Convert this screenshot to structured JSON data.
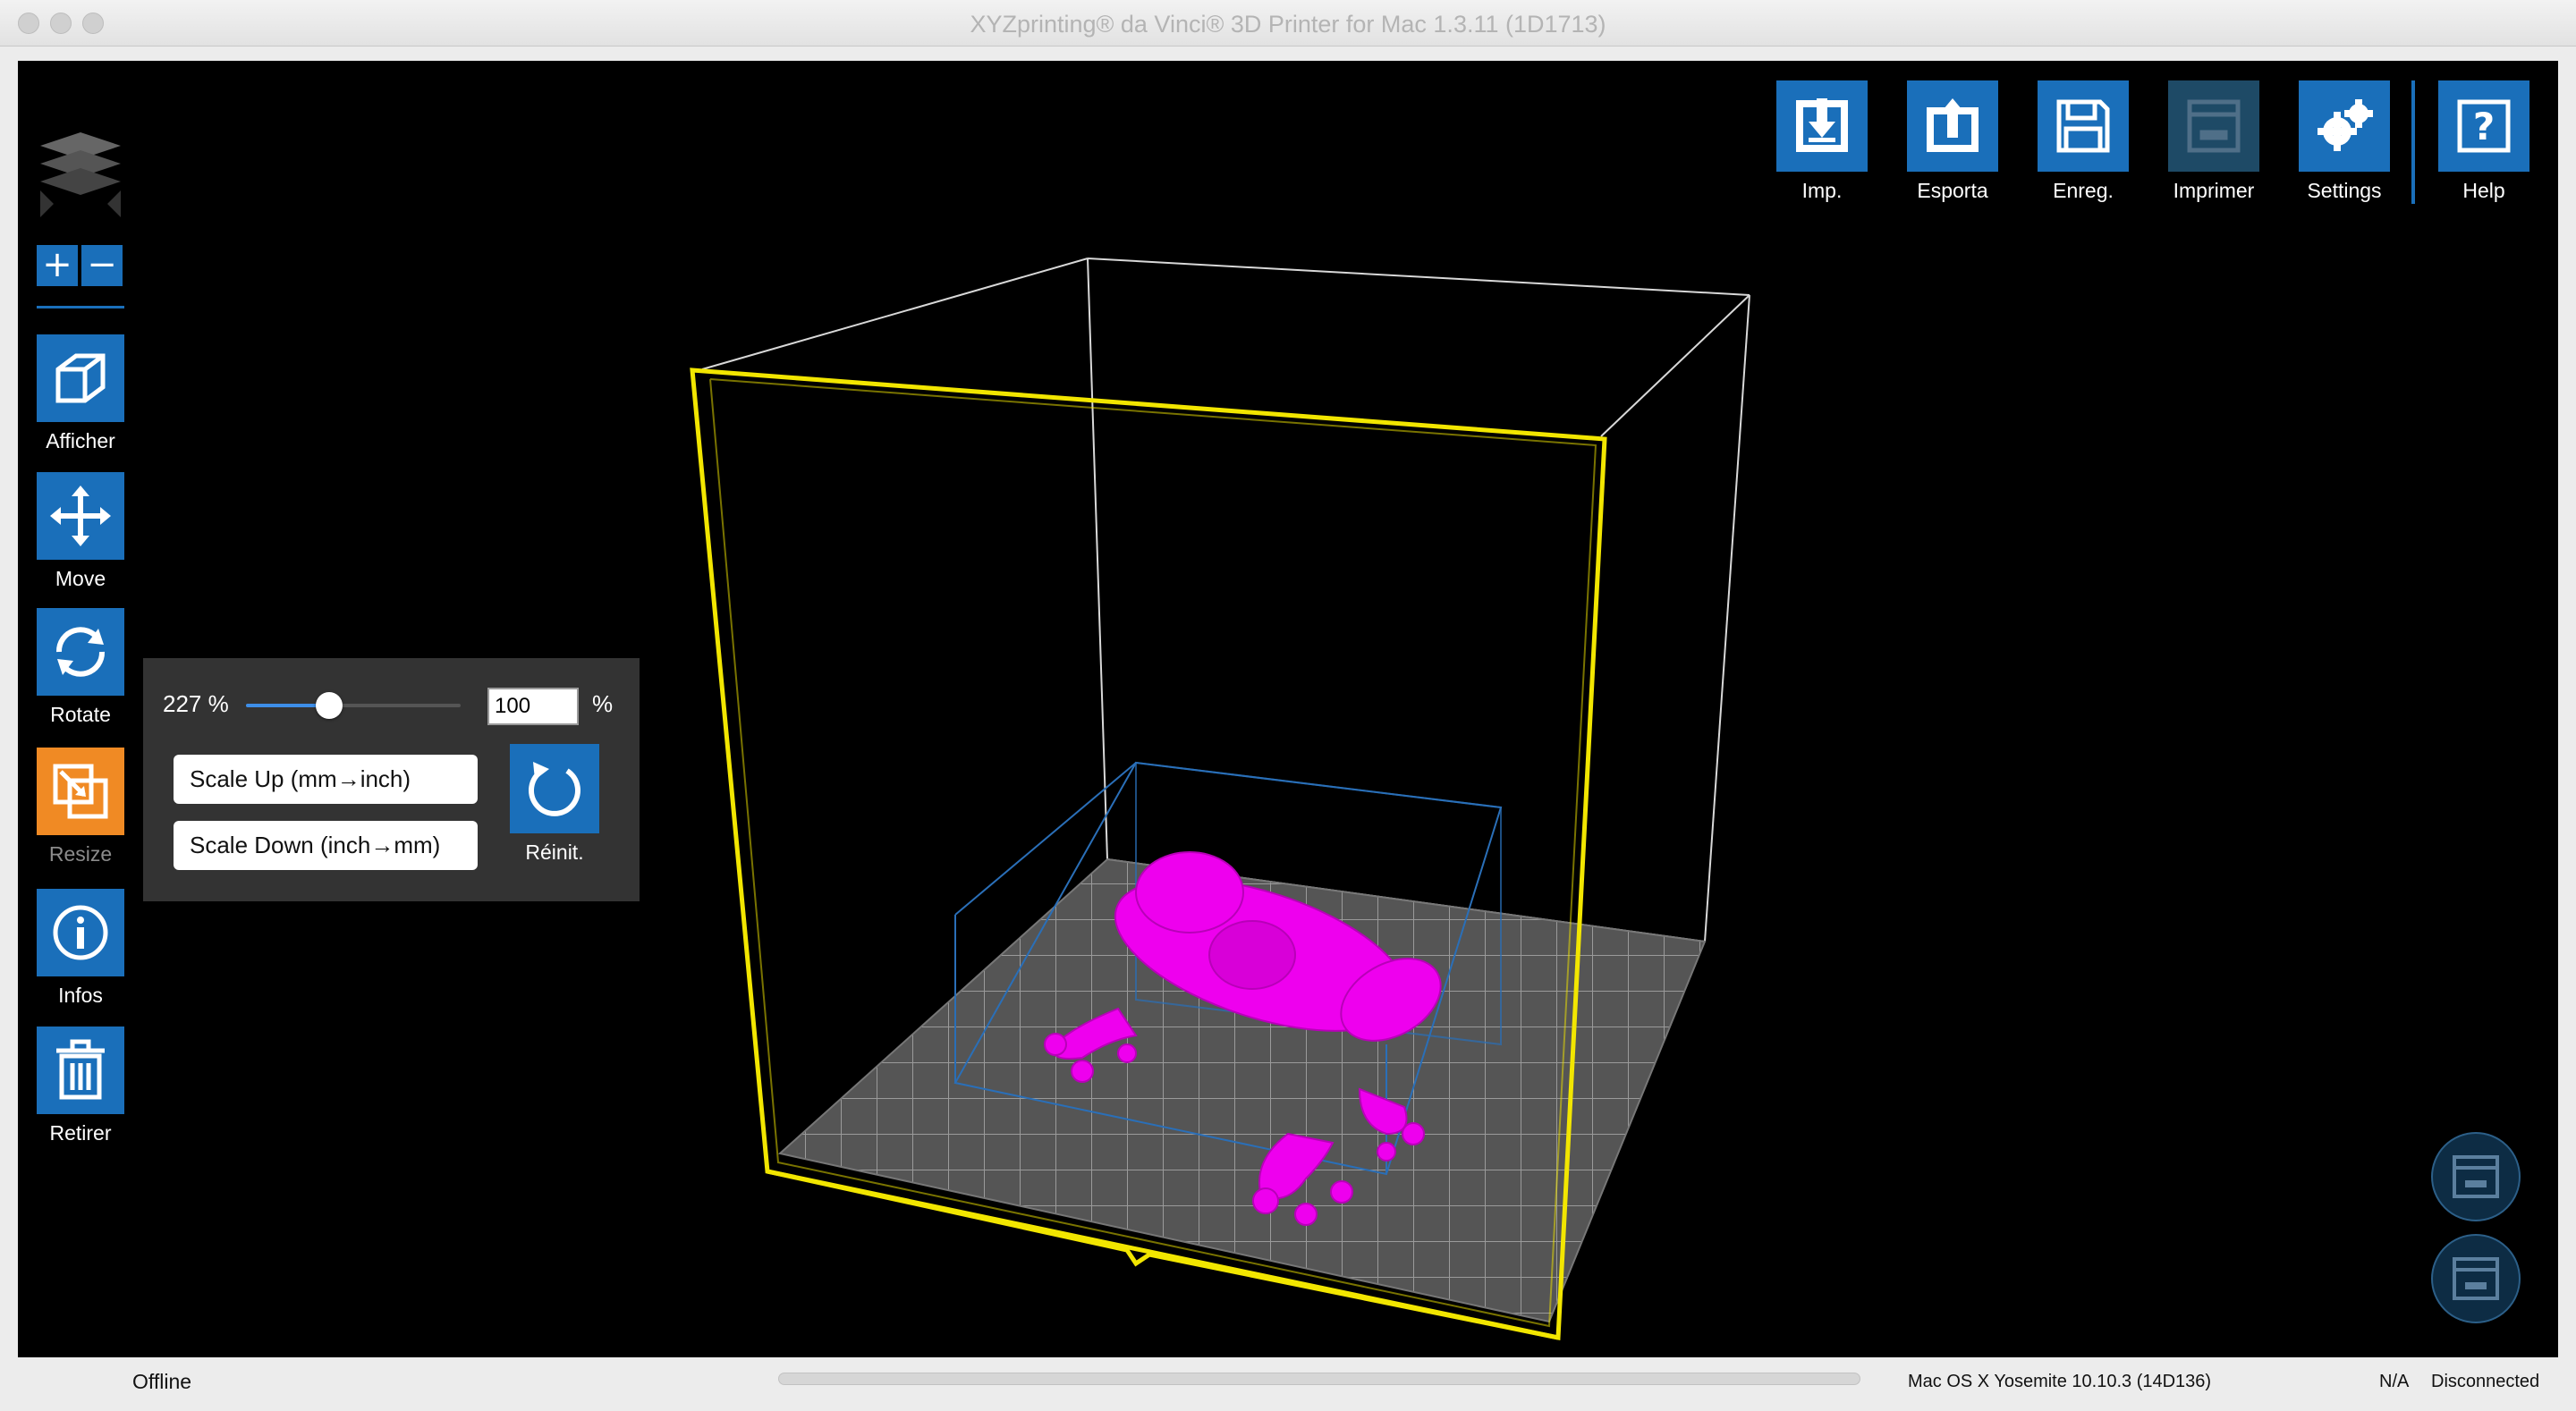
{
  "window": {
    "title": "XYZprinting® da Vinci® 3D Printer for Mac 1.3.11 (1D1713)"
  },
  "zoom": {
    "plus_label": "+",
    "minus_label": "−"
  },
  "left_tools": [
    {
      "label": "Afficher",
      "icon": "cube-icon"
    },
    {
      "label": "Move",
      "icon": "move-arrows-icon"
    },
    {
      "label": "Rotate",
      "icon": "rotate-icon"
    },
    {
      "label": "Resize",
      "icon": "resize-icon",
      "active": true
    },
    {
      "label": "Infos",
      "icon": "info-icon"
    },
    {
      "label": "Retirer",
      "icon": "trash-icon"
    }
  ],
  "top_toolbar": [
    {
      "label": "Imp.",
      "icon": "import-icon"
    },
    {
      "label": "Esporta",
      "icon": "export-icon"
    },
    {
      "label": "Enreg.",
      "icon": "save-icon"
    },
    {
      "label": "Imprimer",
      "icon": "print-icon",
      "disabled": true
    },
    {
      "label": "Settings",
      "icon": "gears-icon"
    },
    {
      "label": "Help",
      "icon": "help-icon"
    }
  ],
  "resize_panel": {
    "scale_label": "227 %",
    "slider_fraction": 0.38,
    "percent_value": "100",
    "percent_sign": "%",
    "scale_up_label": "Scale Up (mm→inch)",
    "scale_down_label": "Scale Down (inch→mm)",
    "reset_label": "Réinit."
  },
  "viewport": {
    "model_color": "#ee00ee",
    "build_volume_color": "#f2e600",
    "model_bounds_color": "#2a6fb8",
    "bed_color": "#5a5a5a"
  },
  "status": {
    "connection_mode": "Offline",
    "os": "Mac OS X Yosemite 10.10.3 (14D136)",
    "value": "N/A",
    "printer_state": "Disconnected"
  },
  "colors": {
    "accent": "#1a6fba",
    "active_tool": "#f08a24",
    "background": "#000000"
  }
}
